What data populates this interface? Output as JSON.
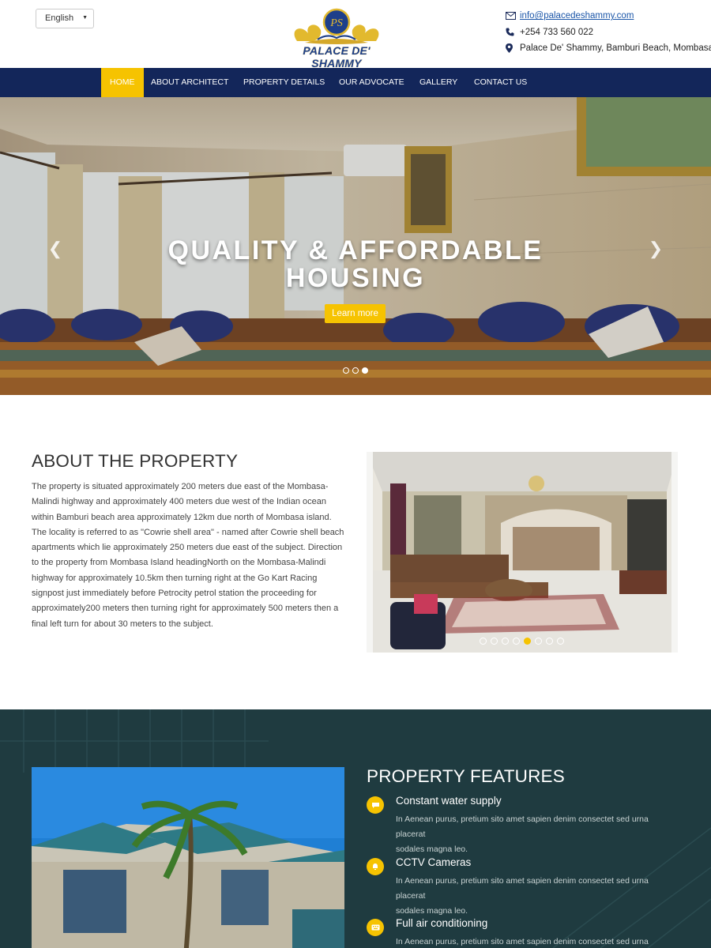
{
  "header": {
    "language": "English",
    "logo_text": "PALACE DE' SHAMMY",
    "logo_monogram": "PS",
    "email": "info@palacedeshammy.com",
    "phone": "+254 733 560 022",
    "address": "Palace De' Shammy, Bamburi Beach, Mombasa"
  },
  "nav": {
    "items": [
      {
        "label": "HOME",
        "active": true
      },
      {
        "label": "ABOUT ARCHITECT"
      },
      {
        "label": "PROPERTY DETAILS"
      },
      {
        "label": "OUR ADVOCATE"
      },
      {
        "label": "GALLERY"
      },
      {
        "label": "CONTACT US"
      }
    ]
  },
  "hero": {
    "title_line1": "QUALITY & AFFORDABLE",
    "title_line2": "HOUSING",
    "button": "Learn more",
    "slide_count": 3,
    "active_slide": 3
  },
  "about": {
    "title": "ABOUT THE PROPERTY",
    "lines": [
      "The property is situated approximately 200 meters due east of the Mombasa-",
      "Malindi highway and approximately 400 meters due west of the Indian ocean",
      "within Bamburi beach area approximately 12km due north of Mombasa island.",
      "The locality is referred to as \"Cowrie shell area\" - named after Cowrie shell beach",
      "apartments which lie approximately 250 meters due east of the subject. Direction",
      "to the property from Mombasa Island headingNorth on the Mombasa-Malindi",
      "highway for approximately 10.5km then turning right at the Go Kart Racing",
      "signpost just immediately before Petrocity petrol station the proceeding for",
      "approximately200 meters then turning right for approximately 500 meters then a",
      "final left turn for about 30 meters to the subject."
    ],
    "gallery_slide_count": 8,
    "gallery_active_slide": 5
  },
  "features": {
    "title": "PROPERTY FEATURES",
    "items": [
      {
        "name": "Constant water supply",
        "desc1": "In Aenean purus, pretium sito amet sapien denim consectet sed urna placerat",
        "desc2": "sodales magna leo.",
        "icon": "chat-icon"
      },
      {
        "name": "CCTV Cameras",
        "desc1": "In Aenean purus, pretium sito amet sapien denim consectet sed urna placerat",
        "desc2": "sodales magna leo.",
        "icon": "bell-icon"
      },
      {
        "name": "Full air conditioning",
        "desc1": "In Aenean purus, pretium sito amet sapien denim consectet sed urna placerat",
        "desc2": "",
        "icon": "keyboard-icon"
      }
    ]
  },
  "colors": {
    "nav_bg": "#13265a",
    "accent": "#f6c301",
    "features_bg": "#1d3a3e"
  }
}
